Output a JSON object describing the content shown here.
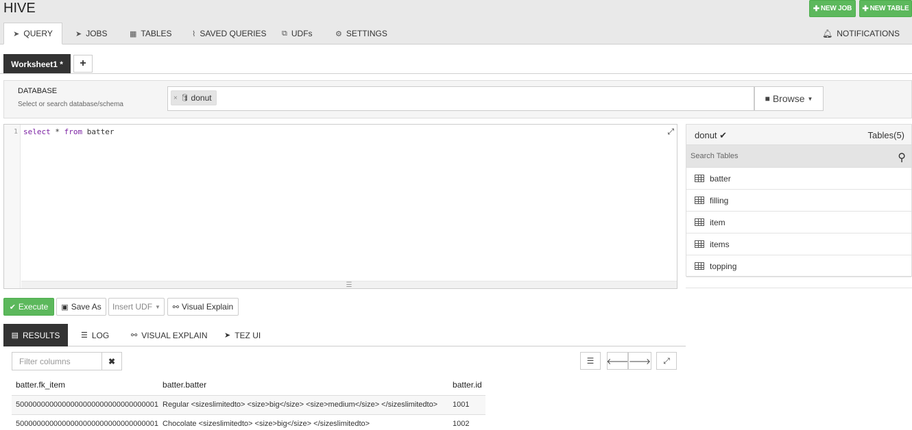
{
  "app": {
    "title": "HIVE"
  },
  "top_buttons": {
    "new_job": "NEW JOB",
    "new_table": "NEW TABLE"
  },
  "nav": {
    "tabs": [
      {
        "label": "QUERY",
        "icon": "paper-plane-icon",
        "active": true
      },
      {
        "label": "JOBS",
        "icon": "paper-plane-icon"
      },
      {
        "label": "TABLES",
        "icon": "table-icon"
      },
      {
        "label": "SAVED QUERIES",
        "icon": "paperclip-icon"
      },
      {
        "label": "UDFs",
        "icon": "puzzle-icon"
      },
      {
        "label": "SETTINGS",
        "icon": "gear-icon"
      }
    ],
    "notifications": "NOTIFICATIONS"
  },
  "worksheet": {
    "tab_label": "Worksheet1 *",
    "add_label": "+"
  },
  "database": {
    "label": "DATABASE",
    "help": "Select or search database/schema",
    "selected": "donut",
    "chip_remove": "×",
    "browse_label": "Browse"
  },
  "editor": {
    "line_number": "1",
    "kw_select": "select",
    "rest1": " * ",
    "kw_from": "from",
    "rest2": " batter"
  },
  "tables_panel": {
    "db_name": "donut",
    "count_label": "Tables(5)",
    "search_placeholder": "Search Tables",
    "tables": [
      "batter",
      "filling",
      "item",
      "items",
      "topping"
    ]
  },
  "actions": {
    "execute": "Execute",
    "save_as": "Save As",
    "insert_udf": "Insert UDF",
    "visual_explain": "Visual Explain"
  },
  "result_tabs": [
    {
      "label": "RESULTS",
      "active": true
    },
    {
      "label": "LOG"
    },
    {
      "label": "VISUAL EXPLAIN"
    },
    {
      "label": "TEZ UI"
    }
  ],
  "results": {
    "filter_placeholder": "Filter columns",
    "columns": [
      "batter.fk_item",
      "batter.batter",
      "batter.id"
    ],
    "rows": [
      [
        "5000000000000000000000000000000001",
        "Regular <sizeslimitedto> <size>big</size> <size>medium</size> </sizeslimitedto>",
        "1001"
      ],
      [
        "5000000000000000000000000000000001",
        "Chocolate <sizeslimitedto> <size>big</size> </sizeslimitedto>",
        "1002"
      ]
    ]
  },
  "colors": {
    "success": "#5cb85c",
    "dark_tab": "#333333",
    "header_bg": "#e9e9e9"
  }
}
